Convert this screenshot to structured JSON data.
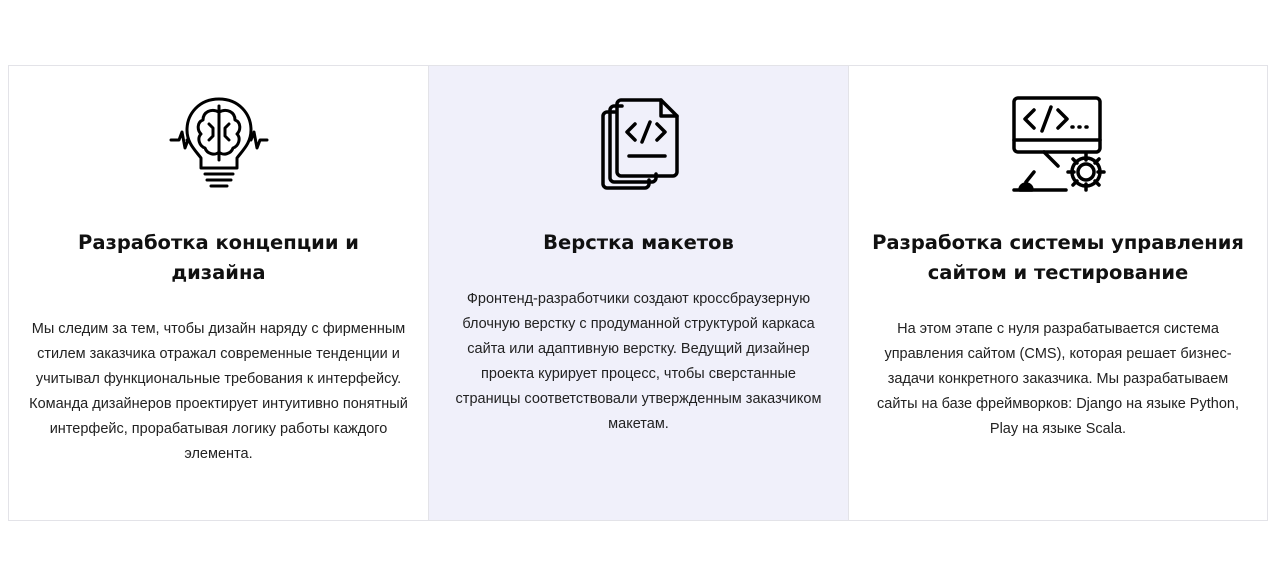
{
  "cards": [
    {
      "icon": "lightbulb-brain-icon",
      "title": "Разработка концепции и дизайна",
      "description": "Мы следим за тем, чтобы дизайн наряду с фирменным стилем заказчика отражал современные тенденции и учитывал функциональные требования к интерфейсу. Команда дизайнеров проектирует интуитивно понятный интерфейс, прорабатывая логику работы каждого элемента."
    },
    {
      "icon": "code-document-stack-icon",
      "title": "Верстка макетов",
      "description": "Фронтенд-разработчики создают кроссбраузерную блочную верстку с продуманной структурой каркаса сайта или адаптивную верстку. Ведущий дизайнер проекта курирует процесс, чтобы сверстанные страницы соответствовали утвержденным заказчиком макетам."
    },
    {
      "icon": "monitor-code-gear-icon",
      "title": "Разработка системы управления сайтом и тестирование",
      "description": "На этом этапе с нуля разрабатывается система управления сайтом (CMS), которая решает бизнес-задачи конкретного заказчика. Мы разрабатываем сайты на базе фреймворков: Django на языке Python, Play на языке Scala."
    }
  ],
  "colors": {
    "highlight_card_bg": "#f0f0fa",
    "border": "#e3e3e8",
    "text": "#111111"
  }
}
